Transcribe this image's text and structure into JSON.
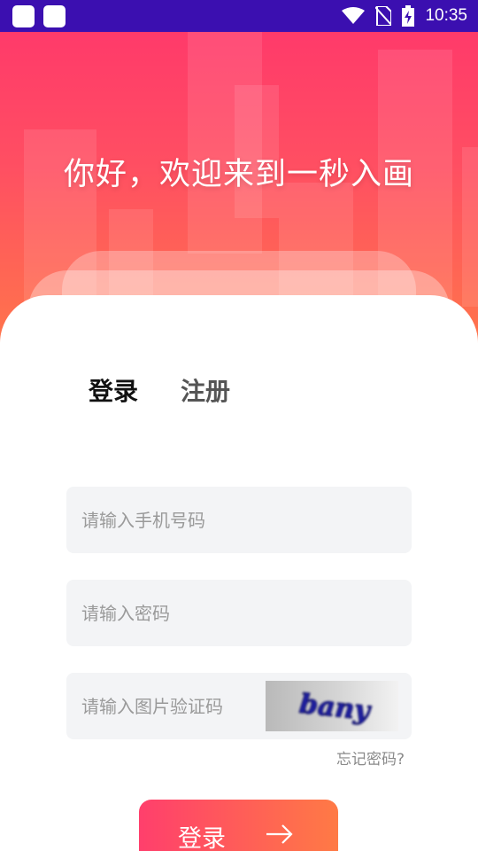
{
  "status_bar": {
    "time": "10:35",
    "icons": [
      "app-notification-icon",
      "app-notification-icon",
      "wifi-icon",
      "no-sim-icon",
      "battery-charging-icon"
    ]
  },
  "hero": {
    "title": "你好，欢迎来到一秒入画"
  },
  "tabs": {
    "login": "登录",
    "register": "注册",
    "active": "login"
  },
  "form": {
    "phone": {
      "placeholder": "请输入手机号码",
      "value": ""
    },
    "password": {
      "placeholder": "请输入密码",
      "value": ""
    },
    "captcha": {
      "placeholder": "请输入图片验证码",
      "value": "",
      "image_text": "bany"
    },
    "forgot_password": "忘记密码?",
    "submit_label": "登录"
  },
  "colors": {
    "status_bar": "#3b0fb0",
    "gradient_start": "#ff3a6a",
    "gradient_end": "#ff7a48",
    "input_bg": "#f3f4f6"
  }
}
